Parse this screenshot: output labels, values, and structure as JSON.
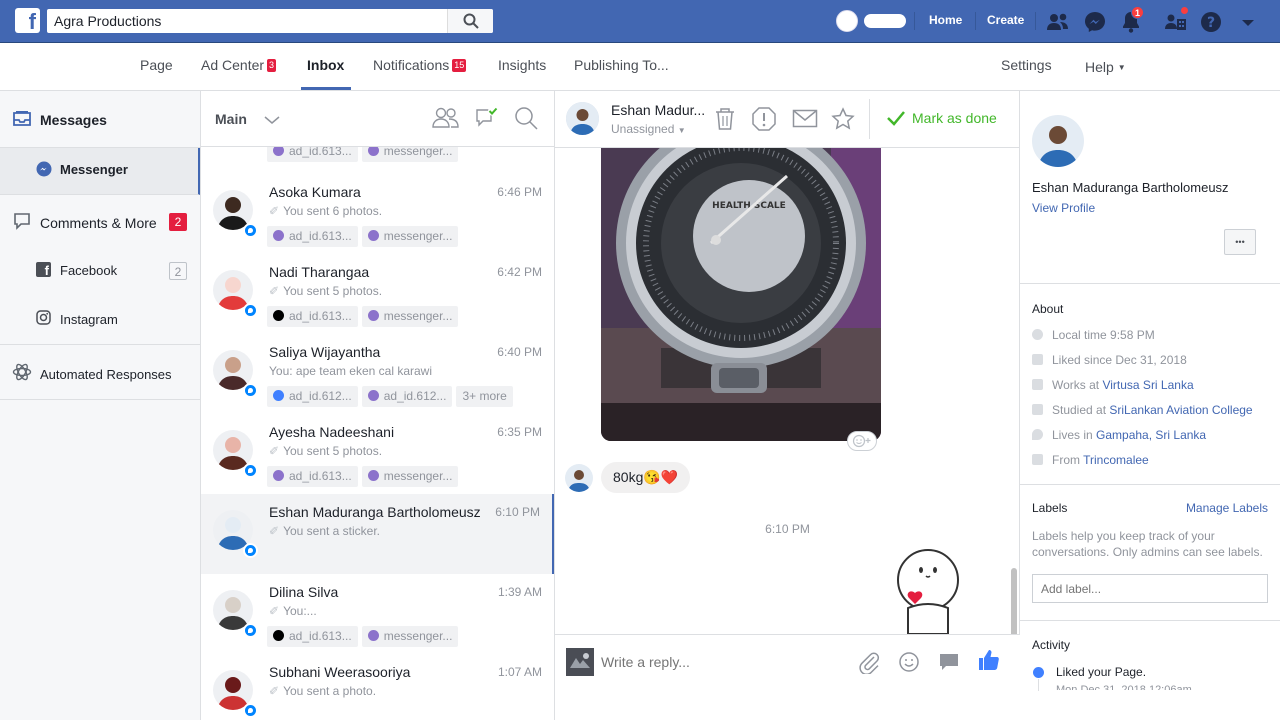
{
  "topbar": {
    "logo": "f",
    "search_value": "Agra Productions",
    "links": {
      "home": "Home",
      "create": "Create"
    },
    "notification_count": "1"
  },
  "pagenav": {
    "items": [
      {
        "label": "Page"
      },
      {
        "label": "Ad Center",
        "badge": "3"
      },
      {
        "label": "Inbox",
        "active": true
      },
      {
        "label": "Notifications",
        "badge": "15"
      },
      {
        "label": "Insights"
      },
      {
        "label": "Publishing To..."
      }
    ],
    "settings": "Settings",
    "help": "Help"
  },
  "leftnav": {
    "messages": "Messages",
    "messenger": "Messenger",
    "comments": "Comments & More",
    "comments_count": "2",
    "facebook": "Facebook",
    "facebook_count": "2",
    "instagram": "Instagram",
    "automated": "Automated Responses"
  },
  "convlist": {
    "filter": "Main",
    "partial_tags": [
      "ad_id.613...",
      "messenger..."
    ],
    "conversations": [
      {
        "name": "Asoka Kumara",
        "time": "6:46 PM",
        "snippet": "You sent 6 photos.",
        "clip": true,
        "tags": [
          {
            "label": "ad_id.613...",
            "color": "#8c72cb"
          },
          {
            "label": "messenger...",
            "color": "#8c72cb"
          }
        ]
      },
      {
        "name": "Nadi Tharangaa",
        "time": "6:42 PM",
        "snippet": "You sent 5 photos.",
        "clip": true,
        "tags": [
          {
            "label": "ad_id.613...",
            "color": "#000000"
          },
          {
            "label": "messenger...",
            "color": "#8c72cb"
          }
        ]
      },
      {
        "name": "Saliya Wijayantha",
        "time": "6:40 PM",
        "snippet": "You: ape team eken cal karawi",
        "clip": false,
        "tags": [
          {
            "label": "ad_id.612...",
            "color": "#4080ff"
          },
          {
            "label": "ad_id.612...",
            "color": "#8c72cb"
          },
          {
            "label": "3+ more",
            "color": ""
          }
        ]
      },
      {
        "name": "Ayesha Nadeeshani",
        "time": "6:35 PM",
        "snippet": "You sent 5 photos.",
        "clip": true,
        "tags": [
          {
            "label": "ad_id.613...",
            "color": "#8c72cb"
          },
          {
            "label": "messenger...",
            "color": "#8c72cb"
          }
        ]
      },
      {
        "name": "Eshan Maduranga Bartholomeusz",
        "time": "6:10 PM",
        "snippet": "You sent a sticker.",
        "clip": true,
        "tags": [],
        "selected": true
      },
      {
        "name": "Dilina Silva",
        "time": "1:39 AM",
        "snippet": "You:...",
        "clip": true,
        "tags": [
          {
            "label": "ad_id.613...",
            "color": "#000000"
          },
          {
            "label": "messenger...",
            "color": "#8c72cb"
          }
        ]
      },
      {
        "name": "Subhani Weerasooriya",
        "time": "1:07 AM",
        "snippet": "You sent a photo.",
        "clip": true,
        "tags": []
      }
    ]
  },
  "chat": {
    "contact_name": "Eshan Madur...",
    "assignment": "Unassigned",
    "mark_done": "Mark as done",
    "scale_label": "HEALTH SCALE",
    "message_text": "80kg😘❤️",
    "timestamp": "6:10 PM",
    "reply_placeholder": "Write a reply..."
  },
  "details": {
    "name": "Eshan Maduranga Bartholomeusz",
    "view_profile": "View Profile",
    "more": "•••",
    "about_title": "About",
    "local_time": "Local time 9:58 PM",
    "liked_since": "Liked since Dec 31, 2018",
    "works_prefix": "Works at ",
    "works_link": "Virtusa Sri Lanka",
    "studied_prefix": "Studied at ",
    "studied_link": "SriLankan Aviation College",
    "lives_prefix": "Lives in ",
    "lives_link": "Gampaha, Sri Lanka",
    "from_prefix": "From ",
    "from_link": "Trincomalee",
    "labels_title": "Labels",
    "manage_labels": "Manage Labels",
    "labels_help": "Labels help you keep track of your conversations. Only admins can see labels.",
    "add_label_placeholder": "Add label...",
    "activity_title": "Activity",
    "activity_item": "Liked your Page.",
    "activity_date": "Mon Dec 31, 2018 12:06am"
  },
  "colors": {
    "brand": "#4267b2",
    "messenger": "#0084ff",
    "done_green": "#42b72a",
    "badge_red": "#e41e3f"
  }
}
